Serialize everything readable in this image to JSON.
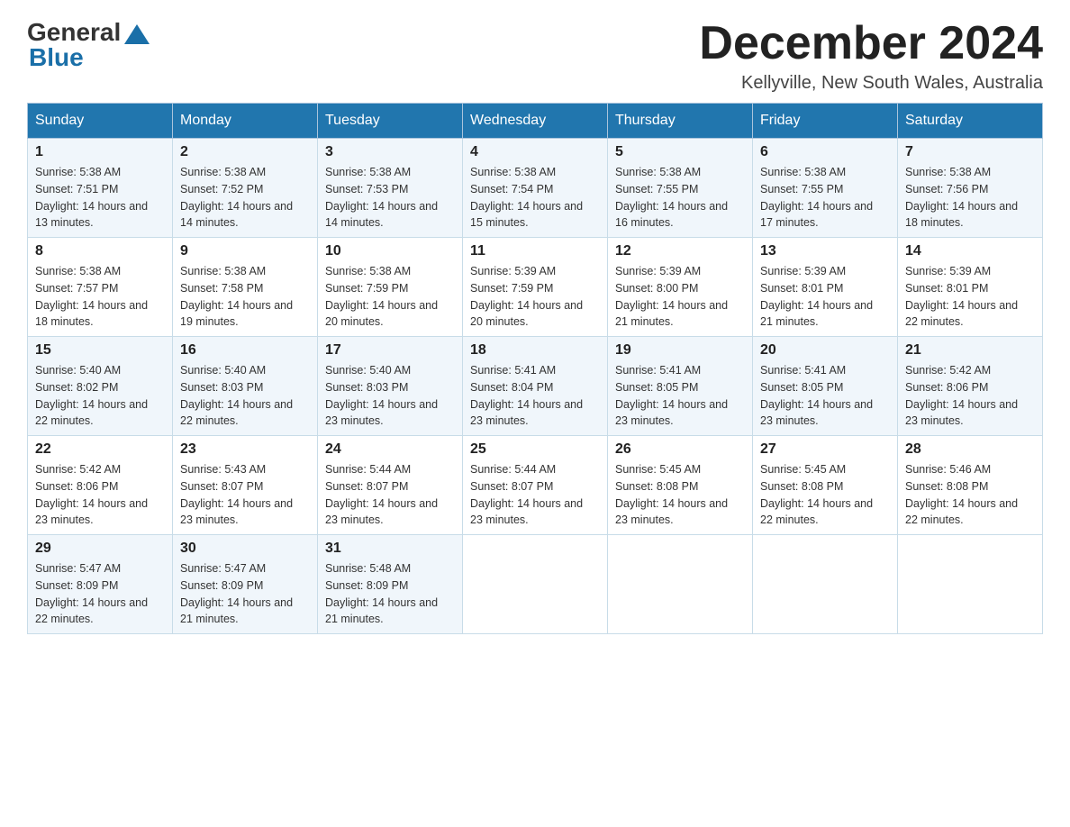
{
  "header": {
    "logo_general": "General",
    "logo_blue": "Blue",
    "month_title": "December 2024",
    "location": "Kellyville, New South Wales, Australia"
  },
  "weekdays": [
    "Sunday",
    "Monday",
    "Tuesday",
    "Wednesday",
    "Thursday",
    "Friday",
    "Saturday"
  ],
  "weeks": [
    [
      {
        "day": "1",
        "sunrise": "5:38 AM",
        "sunset": "7:51 PM",
        "daylight": "14 hours and 13 minutes."
      },
      {
        "day": "2",
        "sunrise": "5:38 AM",
        "sunset": "7:52 PM",
        "daylight": "14 hours and 14 minutes."
      },
      {
        "day": "3",
        "sunrise": "5:38 AM",
        "sunset": "7:53 PM",
        "daylight": "14 hours and 14 minutes."
      },
      {
        "day": "4",
        "sunrise": "5:38 AM",
        "sunset": "7:54 PM",
        "daylight": "14 hours and 15 minutes."
      },
      {
        "day": "5",
        "sunrise": "5:38 AM",
        "sunset": "7:55 PM",
        "daylight": "14 hours and 16 minutes."
      },
      {
        "day": "6",
        "sunrise": "5:38 AM",
        "sunset": "7:55 PM",
        "daylight": "14 hours and 17 minutes."
      },
      {
        "day": "7",
        "sunrise": "5:38 AM",
        "sunset": "7:56 PM",
        "daylight": "14 hours and 18 minutes."
      }
    ],
    [
      {
        "day": "8",
        "sunrise": "5:38 AM",
        "sunset": "7:57 PM",
        "daylight": "14 hours and 18 minutes."
      },
      {
        "day": "9",
        "sunrise": "5:38 AM",
        "sunset": "7:58 PM",
        "daylight": "14 hours and 19 minutes."
      },
      {
        "day": "10",
        "sunrise": "5:38 AM",
        "sunset": "7:59 PM",
        "daylight": "14 hours and 20 minutes."
      },
      {
        "day": "11",
        "sunrise": "5:39 AM",
        "sunset": "7:59 PM",
        "daylight": "14 hours and 20 minutes."
      },
      {
        "day": "12",
        "sunrise": "5:39 AM",
        "sunset": "8:00 PM",
        "daylight": "14 hours and 21 minutes."
      },
      {
        "day": "13",
        "sunrise": "5:39 AM",
        "sunset": "8:01 PM",
        "daylight": "14 hours and 21 minutes."
      },
      {
        "day": "14",
        "sunrise": "5:39 AM",
        "sunset": "8:01 PM",
        "daylight": "14 hours and 22 minutes."
      }
    ],
    [
      {
        "day": "15",
        "sunrise": "5:40 AM",
        "sunset": "8:02 PM",
        "daylight": "14 hours and 22 minutes."
      },
      {
        "day": "16",
        "sunrise": "5:40 AM",
        "sunset": "8:03 PM",
        "daylight": "14 hours and 22 minutes."
      },
      {
        "day": "17",
        "sunrise": "5:40 AM",
        "sunset": "8:03 PM",
        "daylight": "14 hours and 23 minutes."
      },
      {
        "day": "18",
        "sunrise": "5:41 AM",
        "sunset": "8:04 PM",
        "daylight": "14 hours and 23 minutes."
      },
      {
        "day": "19",
        "sunrise": "5:41 AM",
        "sunset": "8:05 PM",
        "daylight": "14 hours and 23 minutes."
      },
      {
        "day": "20",
        "sunrise": "5:41 AM",
        "sunset": "8:05 PM",
        "daylight": "14 hours and 23 minutes."
      },
      {
        "day": "21",
        "sunrise": "5:42 AM",
        "sunset": "8:06 PM",
        "daylight": "14 hours and 23 minutes."
      }
    ],
    [
      {
        "day": "22",
        "sunrise": "5:42 AM",
        "sunset": "8:06 PM",
        "daylight": "14 hours and 23 minutes."
      },
      {
        "day": "23",
        "sunrise": "5:43 AM",
        "sunset": "8:07 PM",
        "daylight": "14 hours and 23 minutes."
      },
      {
        "day": "24",
        "sunrise": "5:44 AM",
        "sunset": "8:07 PM",
        "daylight": "14 hours and 23 minutes."
      },
      {
        "day": "25",
        "sunrise": "5:44 AM",
        "sunset": "8:07 PM",
        "daylight": "14 hours and 23 minutes."
      },
      {
        "day": "26",
        "sunrise": "5:45 AM",
        "sunset": "8:08 PM",
        "daylight": "14 hours and 23 minutes."
      },
      {
        "day": "27",
        "sunrise": "5:45 AM",
        "sunset": "8:08 PM",
        "daylight": "14 hours and 22 minutes."
      },
      {
        "day": "28",
        "sunrise": "5:46 AM",
        "sunset": "8:08 PM",
        "daylight": "14 hours and 22 minutes."
      }
    ],
    [
      {
        "day": "29",
        "sunrise": "5:47 AM",
        "sunset": "8:09 PM",
        "daylight": "14 hours and 22 minutes."
      },
      {
        "day": "30",
        "sunrise": "5:47 AM",
        "sunset": "8:09 PM",
        "daylight": "14 hours and 21 minutes."
      },
      {
        "day": "31",
        "sunrise": "5:48 AM",
        "sunset": "8:09 PM",
        "daylight": "14 hours and 21 minutes."
      },
      null,
      null,
      null,
      null
    ]
  ]
}
